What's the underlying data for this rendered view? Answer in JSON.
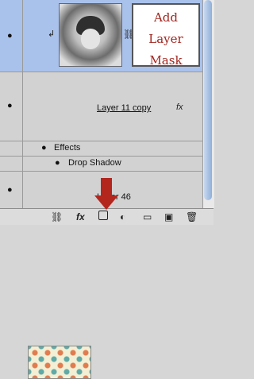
{
  "layers": {
    "adjustment_layer": {
      "annotation": [
        "Add",
        "Layer",
        "Mask"
      ]
    },
    "layer11": {
      "name": "Layer 11 copy",
      "fx": "fx"
    },
    "effects": {
      "label": "Effects"
    },
    "drop_shadow": {
      "label": "Drop Shadow"
    },
    "layer46": {
      "name": "Layer 46"
    }
  },
  "toolbar": [
    "link-icon",
    "fx",
    "add-mask-icon",
    "adjustment-icon",
    "folder-icon",
    "new-layer-icon",
    "trash-icon"
  ]
}
